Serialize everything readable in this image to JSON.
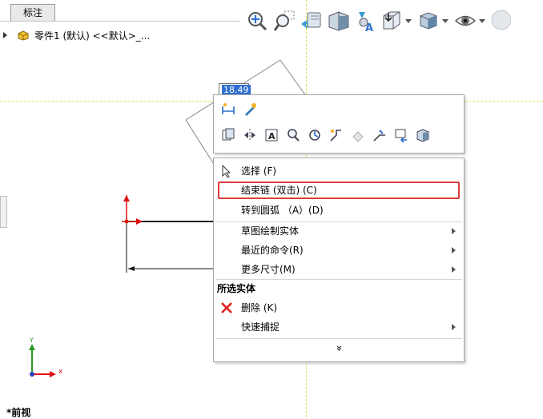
{
  "tab": {
    "label": "标注"
  },
  "tree": {
    "part_label": "零件1 (默认) <<默认>_..."
  },
  "dimension": {
    "value": "18.49"
  },
  "context_menu": {
    "items": [
      {
        "label": "选择 (F)"
      },
      {
        "label": "结束链 (双击) (C)"
      },
      {
        "label": "转到圆弧 （A）(D)"
      },
      {
        "label": "草图绘制实体"
      },
      {
        "label": "最近的命令(R)"
      },
      {
        "label": "更多尺寸(M)"
      }
    ],
    "section_title": "所选实体",
    "items2": [
      {
        "label": "删除 (K)"
      },
      {
        "label": "快速捕捉"
      }
    ],
    "expand_glyph": "»"
  },
  "triad": {
    "x_label": "x",
    "y_label": "Y"
  },
  "view": {
    "name": "*前视"
  },
  "colors": {
    "accent": "#2f6fcf",
    "highlight": "#e03a3a",
    "sketch_red": "#e01010"
  }
}
